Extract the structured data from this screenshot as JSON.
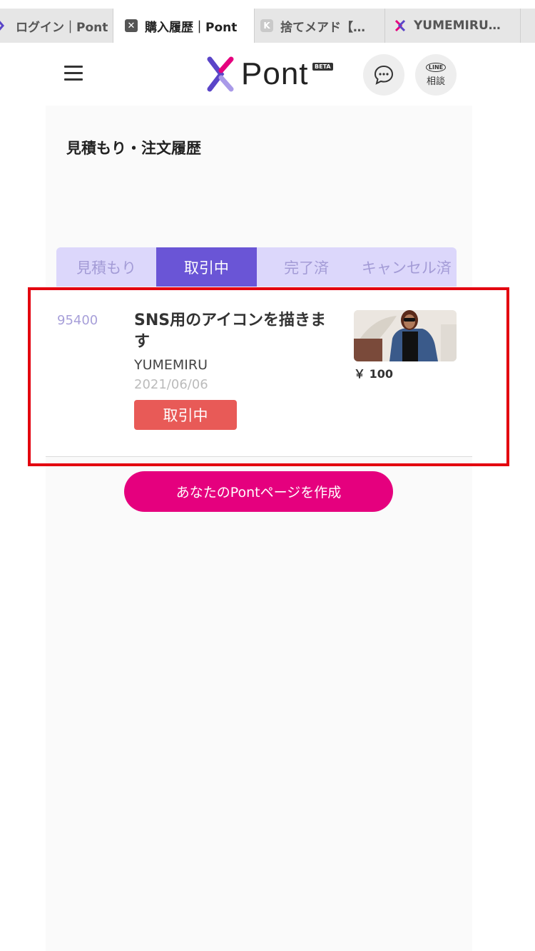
{
  "browser_tabs": [
    {
      "label": "ログイン｜Pont",
      "icon": "pont-icon"
    },
    {
      "label": "購入履歴｜Pont",
      "icon": "close-box-icon"
    },
    {
      "label": "捨てメアド【…",
      "icon": "k-icon"
    },
    {
      "label": "YUMEMIRU…",
      "icon": "pont-icon"
    }
  ],
  "header": {
    "logo_text": "Pont",
    "beta_label": "BETA",
    "line_small": "LINE",
    "line_label": "相談"
  },
  "page": {
    "title": "見積もり・注文履歴"
  },
  "tabs": [
    {
      "label": "見積もり"
    },
    {
      "label": "取引中"
    },
    {
      "label": "完了済"
    },
    {
      "label": "キャンセル済"
    }
  ],
  "order": {
    "id": "95400",
    "title": "SNS用のアイコンを描きます",
    "seller": "YUMEMIRU",
    "date": "2021/06/06",
    "status": "取引中",
    "price": "￥ 100"
  },
  "cta": {
    "label": "あなたのPontページを作成"
  },
  "colors": {
    "accent_purple": "#6a55d6",
    "tab_inactive_bg": "#dcd7fb",
    "status_red": "#e85a57",
    "cta_pink": "#e5007e",
    "highlight_red": "#e3000f"
  }
}
